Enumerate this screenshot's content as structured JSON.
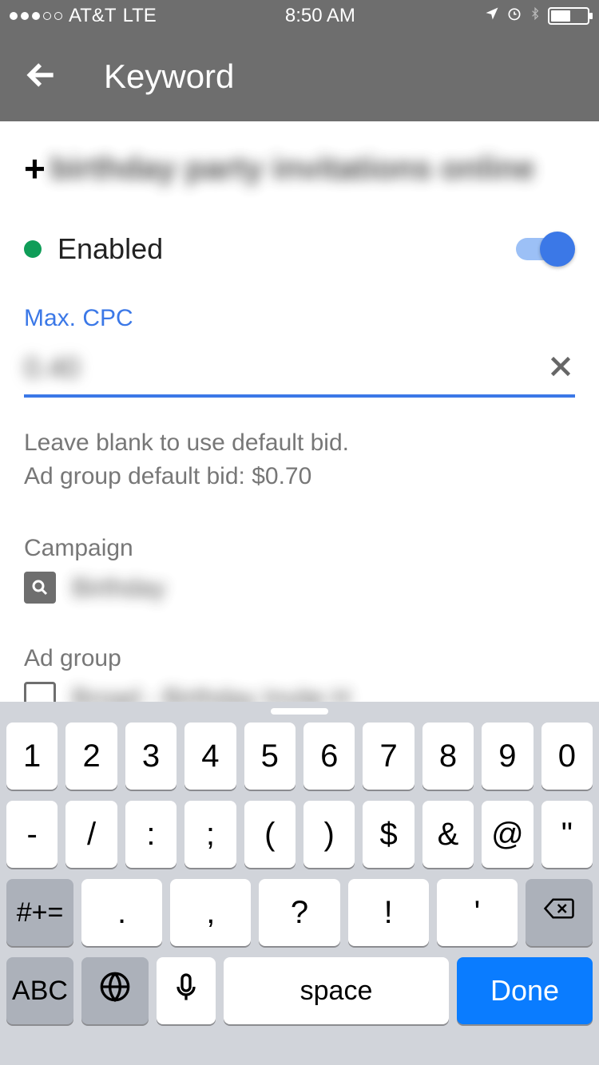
{
  "statusbar": {
    "carrier": "AT&T",
    "network": "LTE",
    "time": "8:50 AM"
  },
  "header": {
    "title": "Keyword"
  },
  "keyword": {
    "prefix": "+",
    "text": "birthday party invitations online"
  },
  "status": {
    "label": "Enabled",
    "enabled": true
  },
  "max_cpc": {
    "label": "Max. CPC",
    "value": "0.40",
    "helper_line1": "Leave blank to use default bid.",
    "helper_line2": "Ad group default bid: $0.70"
  },
  "campaign": {
    "label": "Campaign",
    "value": "Birthday"
  },
  "adgroup": {
    "label": "Ad group",
    "value": "Broad - Birthday Invite H"
  },
  "keyboard": {
    "row1": [
      "1",
      "2",
      "3",
      "4",
      "5",
      "6",
      "7",
      "8",
      "9",
      "0"
    ],
    "row2": [
      "-",
      "/",
      ":",
      ";",
      "(",
      ")",
      "$",
      "&",
      "@",
      "\""
    ],
    "row3_sym": "#+=",
    "row3_keys": [
      ".",
      ",",
      "?",
      "!",
      "'"
    ],
    "abc": "ABC",
    "space": "space",
    "done": "Done"
  }
}
